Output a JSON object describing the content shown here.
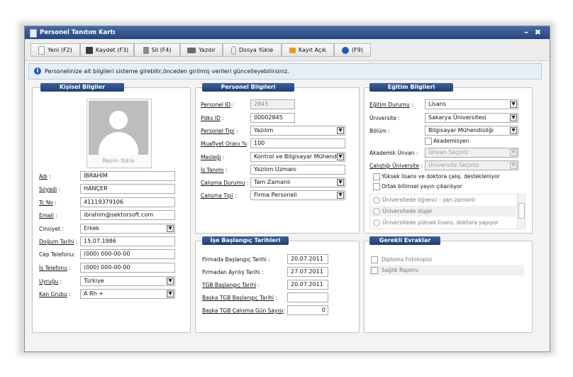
{
  "window": {
    "title": "Personel Tanıtım Kartı",
    "minimize": "–",
    "close": "✖"
  },
  "toolbar": {
    "buttons": [
      {
        "label": "Yeni (F2)",
        "icon": "new-document-icon",
        "color": "#f4f4f4"
      },
      {
        "label": "Kaydet (F3)",
        "icon": "save-disk-icon",
        "color": "#3a3a3a"
      },
      {
        "label": "Sil (F4)",
        "icon": "trash-icon",
        "color": "#8a8a8a"
      },
      {
        "label": "Yazdır",
        "icon": "printer-icon",
        "color": "#6a6a6a"
      },
      {
        "label": "Dosya Yükle",
        "icon": "paperclip-icon",
        "color": "#9a9a9a"
      },
      {
        "label": "Kayıt Açık",
        "icon": "unlock-icon",
        "color": "#e0a020"
      },
      {
        "label": "(F9)",
        "icon": "help-icon",
        "color": "#2459b3"
      }
    ]
  },
  "info": {
    "text": "Personelinize ait bilgileri sisteme girebilir,önceden girilmiş verileri güncelleyebilirsiniz."
  },
  "personal": {
    "title": "Kişisel Bilgiler",
    "photo_button": "Resim Yükle",
    "fields": [
      {
        "label": "Adı",
        "value": "İBRAHİM"
      },
      {
        "label": "Soyadı",
        "value": "HANÇER"
      },
      {
        "label": "Tc No",
        "value": "41119379106"
      },
      {
        "label": "Email",
        "value": "ibrahim@sektorsoft.com"
      },
      {
        "label": "Cinsiyet",
        "value": "Erkek"
      },
      {
        "label": "Doğum Tarihi",
        "value": "15.07.1986"
      },
      {
        "label": "Cep Telefonu",
        "value": "(000) 000-00-00"
      },
      {
        "label": "İş Telefonu",
        "value": "(000) 000-00-00"
      },
      {
        "label": "Uyruğu",
        "value": "Türkiye"
      },
      {
        "label": "Kan Grubu",
        "value": "A Rh +"
      }
    ]
  },
  "staff": {
    "title": "Personel Bilgileri",
    "fields": [
      {
        "label": "Personel ID",
        "value": "2845"
      },
      {
        "label": "Pdks ID",
        "value": "00002845"
      },
      {
        "label": "Personel Tipi",
        "value": "Yazılım"
      },
      {
        "label": "Muafiyet Oranı %",
        "value": "100"
      },
      {
        "label": "Mesleği",
        "value": "Kontrol ve Bilgisayar Mühendisi"
      },
      {
        "label": "İş Tanımı",
        "value": "Yazılım Uzmanı"
      },
      {
        "label": "Çalışma Durumu",
        "value": "Tam Zamanlı"
      },
      {
        "label": "Çalışma Tipi",
        "value": "Firma Personeli"
      }
    ]
  },
  "education": {
    "title": "Eğitim Bilgileri",
    "fields": [
      {
        "label": "Eğitim Durumu",
        "value": "Lisans"
      },
      {
        "label": "Üniversite",
        "value": "Sakarya Üniversitesi"
      },
      {
        "label": "Bölüm",
        "value": "Bilgisayar Mühendisliği"
      },
      {
        "label": "Akademik Ünvan",
        "value": "Ünvan Seçiniz"
      },
      {
        "label": "Çalıştığı Üniversite",
        "value": "Üniversite Seçiniz"
      }
    ],
    "academic_checkbox": "Akademisyen",
    "checks": [
      "Yüksek lisans ve doktora çalış. destekleniyor",
      "Ortak bilimsel yayın çıkarılıyor"
    ],
    "radios": [
      "Üniversitede öğrenci - yarı zamanlı",
      "Üniversitede stajer",
      "Üniversitede yüksek lisans, doktora yapıyor"
    ]
  },
  "start_dates": {
    "title": "İşe Başlangıç Tarihleri",
    "fields": [
      {
        "label": "Firmada Başlangıç Tarihi",
        "value": "20.07.2011"
      },
      {
        "label": "Firmadan Ayrılış Tarihi",
        "value": "27.07.2011"
      },
      {
        "label": "TGB Başlangıç Tarihi",
        "value": "20.07.2011"
      },
      {
        "label": "Başka TGB Başlangıç Tarihi",
        "value": ""
      },
      {
        "label": "Başka TGB Çalısma Gün Sayısı",
        "value": "0"
      }
    ]
  },
  "documents": {
    "title": "Gerekli Evraklar",
    "items": [
      "Diploma Fotokopisi",
      "Sağlık Raporu"
    ]
  }
}
